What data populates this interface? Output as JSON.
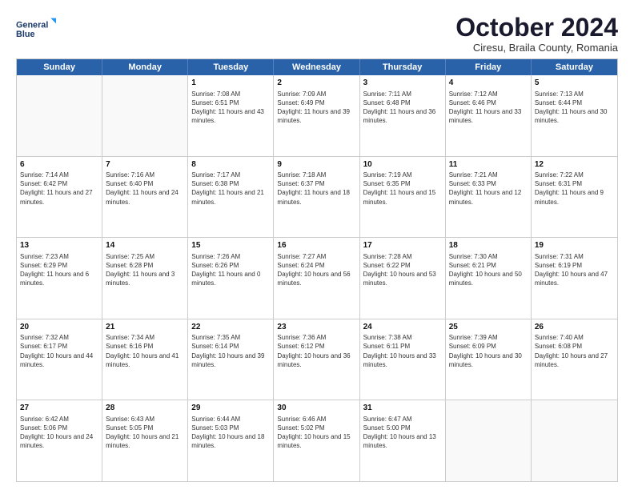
{
  "logo": {
    "line1": "General",
    "line2": "Blue"
  },
  "title": "October 2024",
  "subtitle": "Ciresu, Braila County, Romania",
  "header_days": [
    "Sunday",
    "Monday",
    "Tuesday",
    "Wednesday",
    "Thursday",
    "Friday",
    "Saturday"
  ],
  "weeks": [
    [
      {
        "day": "",
        "info": ""
      },
      {
        "day": "",
        "info": ""
      },
      {
        "day": "1",
        "info": "Sunrise: 7:08 AM\nSunset: 6:51 PM\nDaylight: 11 hours and 43 minutes."
      },
      {
        "day": "2",
        "info": "Sunrise: 7:09 AM\nSunset: 6:49 PM\nDaylight: 11 hours and 39 minutes."
      },
      {
        "day": "3",
        "info": "Sunrise: 7:11 AM\nSunset: 6:48 PM\nDaylight: 11 hours and 36 minutes."
      },
      {
        "day": "4",
        "info": "Sunrise: 7:12 AM\nSunset: 6:46 PM\nDaylight: 11 hours and 33 minutes."
      },
      {
        "day": "5",
        "info": "Sunrise: 7:13 AM\nSunset: 6:44 PM\nDaylight: 11 hours and 30 minutes."
      }
    ],
    [
      {
        "day": "6",
        "info": "Sunrise: 7:14 AM\nSunset: 6:42 PM\nDaylight: 11 hours and 27 minutes."
      },
      {
        "day": "7",
        "info": "Sunrise: 7:16 AM\nSunset: 6:40 PM\nDaylight: 11 hours and 24 minutes."
      },
      {
        "day": "8",
        "info": "Sunrise: 7:17 AM\nSunset: 6:38 PM\nDaylight: 11 hours and 21 minutes."
      },
      {
        "day": "9",
        "info": "Sunrise: 7:18 AM\nSunset: 6:37 PM\nDaylight: 11 hours and 18 minutes."
      },
      {
        "day": "10",
        "info": "Sunrise: 7:19 AM\nSunset: 6:35 PM\nDaylight: 11 hours and 15 minutes."
      },
      {
        "day": "11",
        "info": "Sunrise: 7:21 AM\nSunset: 6:33 PM\nDaylight: 11 hours and 12 minutes."
      },
      {
        "day": "12",
        "info": "Sunrise: 7:22 AM\nSunset: 6:31 PM\nDaylight: 11 hours and 9 minutes."
      }
    ],
    [
      {
        "day": "13",
        "info": "Sunrise: 7:23 AM\nSunset: 6:29 PM\nDaylight: 11 hours and 6 minutes."
      },
      {
        "day": "14",
        "info": "Sunrise: 7:25 AM\nSunset: 6:28 PM\nDaylight: 11 hours and 3 minutes."
      },
      {
        "day": "15",
        "info": "Sunrise: 7:26 AM\nSunset: 6:26 PM\nDaylight: 11 hours and 0 minutes."
      },
      {
        "day": "16",
        "info": "Sunrise: 7:27 AM\nSunset: 6:24 PM\nDaylight: 10 hours and 56 minutes."
      },
      {
        "day": "17",
        "info": "Sunrise: 7:28 AM\nSunset: 6:22 PM\nDaylight: 10 hours and 53 minutes."
      },
      {
        "day": "18",
        "info": "Sunrise: 7:30 AM\nSunset: 6:21 PM\nDaylight: 10 hours and 50 minutes."
      },
      {
        "day": "19",
        "info": "Sunrise: 7:31 AM\nSunset: 6:19 PM\nDaylight: 10 hours and 47 minutes."
      }
    ],
    [
      {
        "day": "20",
        "info": "Sunrise: 7:32 AM\nSunset: 6:17 PM\nDaylight: 10 hours and 44 minutes."
      },
      {
        "day": "21",
        "info": "Sunrise: 7:34 AM\nSunset: 6:16 PM\nDaylight: 10 hours and 41 minutes."
      },
      {
        "day": "22",
        "info": "Sunrise: 7:35 AM\nSunset: 6:14 PM\nDaylight: 10 hours and 39 minutes."
      },
      {
        "day": "23",
        "info": "Sunrise: 7:36 AM\nSunset: 6:12 PM\nDaylight: 10 hours and 36 minutes."
      },
      {
        "day": "24",
        "info": "Sunrise: 7:38 AM\nSunset: 6:11 PM\nDaylight: 10 hours and 33 minutes."
      },
      {
        "day": "25",
        "info": "Sunrise: 7:39 AM\nSunset: 6:09 PM\nDaylight: 10 hours and 30 minutes."
      },
      {
        "day": "26",
        "info": "Sunrise: 7:40 AM\nSunset: 6:08 PM\nDaylight: 10 hours and 27 minutes."
      }
    ],
    [
      {
        "day": "27",
        "info": "Sunrise: 6:42 AM\nSunset: 5:06 PM\nDaylight: 10 hours and 24 minutes."
      },
      {
        "day": "28",
        "info": "Sunrise: 6:43 AM\nSunset: 5:05 PM\nDaylight: 10 hours and 21 minutes."
      },
      {
        "day": "29",
        "info": "Sunrise: 6:44 AM\nSunset: 5:03 PM\nDaylight: 10 hours and 18 minutes."
      },
      {
        "day": "30",
        "info": "Sunrise: 6:46 AM\nSunset: 5:02 PM\nDaylight: 10 hours and 15 minutes."
      },
      {
        "day": "31",
        "info": "Sunrise: 6:47 AM\nSunset: 5:00 PM\nDaylight: 10 hours and 13 minutes."
      },
      {
        "day": "",
        "info": ""
      },
      {
        "day": "",
        "info": ""
      }
    ]
  ]
}
